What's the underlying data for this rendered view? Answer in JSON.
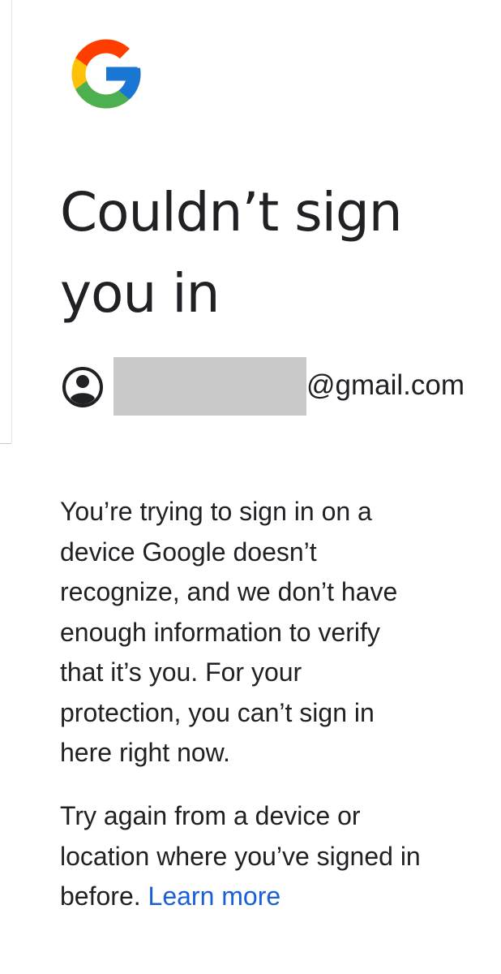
{
  "colors": {
    "text": "#202124",
    "link": "#1a5fd8",
    "redaction": "#c8c8c8",
    "google_red": "#EA4335",
    "google_yellow": "#FBBC05",
    "google_green": "#34A853",
    "google_blue": "#4285F4"
  },
  "logo": {
    "icon": "google-g-logo"
  },
  "title": {
    "line1": "Couldn’t sign",
    "line2": "you in"
  },
  "account": {
    "icon": "account-circle-icon",
    "email_domain": "@gmail.com"
  },
  "message": {
    "lines": [
      "You’re trying to sign in on a",
      "device Google doesn’t",
      "recognize, and we don’t have",
      "enough information to verify",
      "that it’s you. For your",
      "protection, you can’t sign in",
      "here right now."
    ]
  },
  "retry": {
    "line1": "Try again from a device or",
    "line2": "location where you’ve signed in",
    "line3_prefix": "before.",
    "learn_more": "Learn more"
  }
}
